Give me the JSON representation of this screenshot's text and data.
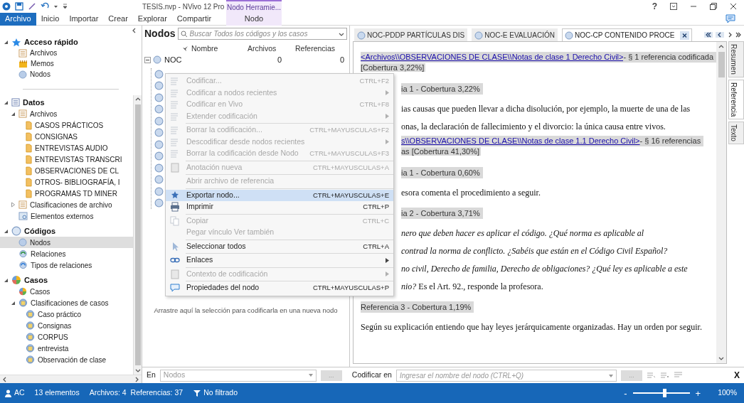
{
  "title_bar": {
    "title": "TESIS.nvp - NVivo 12 Pro",
    "context_group": "Nodo Herramie...",
    "help": "?"
  },
  "ribbon_tabs": [
    {
      "label": "Archivo",
      "selected": true,
      "contextual": false
    },
    {
      "label": "Inicio",
      "selected": false,
      "contextual": false
    },
    {
      "label": "Importar",
      "selected": false,
      "contextual": false
    },
    {
      "label": "Crear",
      "selected": false,
      "contextual": false
    },
    {
      "label": "Explorar",
      "selected": false,
      "contextual": false
    },
    {
      "label": "Compartir",
      "selected": false,
      "contextual": false
    },
    {
      "label": "Nodo",
      "selected": false,
      "contextual": true
    }
  ],
  "sidebar": {
    "quick_access": [
      {
        "label": "Acceso rápido",
        "kind": "star",
        "expanded": true,
        "selected": false,
        "children": [
          {
            "label": "Archivos",
            "kind": "files",
            "selected": false
          },
          {
            "label": "Memos",
            "kind": "memos",
            "selected": false
          },
          {
            "label": "Nodos",
            "kind": "nodes",
            "selected": false
          }
        ]
      }
    ],
    "tree": [
      {
        "label": "Datos",
        "kind": "data",
        "expanded": true,
        "selected": false,
        "children": [
          {
            "label": "Archivos",
            "kind": "files",
            "expanded": true,
            "selected": false,
            "children": [
              {
                "label": "CASOS PRÁCTICOS",
                "kind": "folder",
                "selected": false
              },
              {
                "label": "CONSIGNAS",
                "kind": "folder",
                "selected": false
              },
              {
                "label": "ENTREVISTAS AUDIO",
                "kind": "folder",
                "selected": false
              },
              {
                "label": "ENTREVISTAS TRANSCRI",
                "kind": "folder",
                "selected": false
              },
              {
                "label": "OBSERVACIONES DE CL",
                "kind": "folder",
                "selected": false
              },
              {
                "label": "OTROS- BIBLIOGRAFÍA, I",
                "kind": "folder",
                "selected": false
              },
              {
                "label": "PROGRAMAS TD MINER",
                "kind": "folder",
                "selected": false
              }
            ]
          },
          {
            "label": "Clasificaciones de archivo",
            "kind": "file_classifications",
            "expanded": false,
            "selected": false
          },
          {
            "label": "Elementos externos",
            "kind": "externals",
            "selected": false
          }
        ]
      },
      {
        "label": "Códigos",
        "kind": "codes",
        "expanded": true,
        "selected": false,
        "children": [
          {
            "label": "Nodos",
            "kind": "nodes",
            "selected": true
          },
          {
            "label": "Relaciones",
            "kind": "relations",
            "selected": false
          },
          {
            "label": "Tipos de relaciones",
            "kind": "relation_types",
            "selected": false
          }
        ]
      },
      {
        "label": "Casos",
        "kind": "cases",
        "expanded": true,
        "selected": false,
        "children": [
          {
            "label": "Casos",
            "kind": "case",
            "selected": false
          },
          {
            "label": "Clasificaciones de casos",
            "kind": "case_classifications",
            "expanded": true,
            "selected": false,
            "children": [
              {
                "label": "Caso práctico",
                "kind": "case_classification",
                "selected": false
              },
              {
                "label": "Consignas",
                "kind": "case_classification",
                "selected": false
              },
              {
                "label": "CORPUS",
                "kind": "case_classification",
                "selected": false
              },
              {
                "label": "entrevista",
                "kind": "case_classification",
                "selected": false
              },
              {
                "label": "Observación de clase",
                "kind": "case_classification",
                "selected": false
              }
            ]
          }
        ]
      }
    ]
  },
  "node_list": {
    "title": "Nodos",
    "search": {
      "placeholder": "Buscar Todos los códigos y los casos"
    },
    "columns": [
      "Nombre",
      "Archivos",
      "Referencias"
    ],
    "rows": [
      {
        "name": "NOC",
        "files": "0",
        "references": "0",
        "expanded": true,
        "children": [
          {
            "kind": "node"
          },
          {
            "kind": "node"
          },
          {
            "kind": "node"
          },
          {
            "kind": "node"
          },
          {
            "kind": "node"
          },
          {
            "kind": "node"
          },
          {
            "kind": "node"
          },
          {
            "kind": "node"
          },
          {
            "kind": "node"
          },
          {
            "kind": "node"
          },
          {
            "kind": "node"
          },
          {
            "kind": "node"
          }
        ]
      }
    ],
    "drop_hint": "Arrastre aquí la selección para codificarla en una nueva nodo"
  },
  "context_menu": [
    {
      "kind": "item",
      "label": "Codificar...",
      "shortcut": "CTRL+F2",
      "submenu": false,
      "disabled": true,
      "selected": false
    },
    {
      "kind": "item",
      "label": "Codificar a nodos recientes",
      "submenu": true,
      "disabled": true,
      "selected": false
    },
    {
      "kind": "item",
      "label": "Codificar en Vivo",
      "shortcut": "CTRL+F8",
      "submenu": false,
      "disabled": true,
      "selected": false
    },
    {
      "kind": "item",
      "label": "Extender codificación",
      "submenu": true,
      "disabled": true,
      "selected": false
    },
    {
      "kind": "separator"
    },
    {
      "kind": "item",
      "label": "Borrar la codificación...",
      "shortcut": "CTRL+MAYUSCULAS+F2",
      "submenu": false,
      "disabled": true,
      "selected": false
    },
    {
      "kind": "item",
      "label": "Descodificar desde nodos recientes",
      "submenu": true,
      "disabled": true,
      "selected": false
    },
    {
      "kind": "item",
      "label": "Borrar la codificación desde Nodo",
      "shortcut": "CTRL+MAYUSCULAS+F3",
      "submenu": false,
      "disabled": true,
      "selected": false
    },
    {
      "kind": "separator"
    },
    {
      "kind": "item",
      "label": "Anotación nueva",
      "shortcut": "CTRL+MAYUSCULAS+A",
      "submenu": false,
      "disabled": true,
      "selected": false
    },
    {
      "kind": "separator"
    },
    {
      "kind": "item",
      "label": "Abrir archivo de referencia",
      "submenu": false,
      "disabled": true,
      "selected": false
    },
    {
      "kind": "separator"
    },
    {
      "kind": "item",
      "label": "Exportar nodo...",
      "shortcut": "CTRL+MAYUSCULAS+E",
      "submenu": false,
      "disabled": false,
      "selected": true
    },
    {
      "kind": "item",
      "label": "Imprimir",
      "shortcut": "CTRL+P",
      "submenu": false,
      "disabled": false,
      "selected": false
    },
    {
      "kind": "separator"
    },
    {
      "kind": "item",
      "label": "Copiar",
      "shortcut": "CTRL+C",
      "submenu": false,
      "disabled": true,
      "selected": false
    },
    {
      "kind": "item",
      "label": "Pegar vínculo Ver también",
      "submenu": false,
      "disabled": true,
      "selected": false
    },
    {
      "kind": "separator"
    },
    {
      "kind": "item",
      "label": "Seleccionar todos",
      "shortcut": "CTRL+A",
      "submenu": false,
      "disabled": false,
      "selected": false
    },
    {
      "kind": "separator"
    },
    {
      "kind": "item",
      "label": "Enlaces",
      "submenu": true,
      "disabled": false,
      "selected": false
    },
    {
      "kind": "separator"
    },
    {
      "kind": "item",
      "label": "Contexto de codificación",
      "submenu": true,
      "disabled": true,
      "selected": false
    },
    {
      "kind": "separator"
    },
    {
      "kind": "item",
      "label": "Propiedades del nodo",
      "shortcut": "CTRL+MAYUSCULAS+P",
      "submenu": false,
      "disabled": false,
      "selected": false
    }
  ],
  "detail": {
    "tabs": [
      {
        "label": "NOC-PDDP PARTÍCULAS DIS",
        "selected": false,
        "closable": false
      },
      {
        "label": "NOC-E EVALUACIÓN",
        "selected": false,
        "closable": false
      },
      {
        "label": "NOC-CP CONTENIDO PROCE",
        "selected": true,
        "closable": true
      }
    ],
    "lines": [
      {
        "kind": "source",
        "link": "<Archivos\\\\OBSERVACIONES DE CLASE\\\\Notas de clase 1 Derecho Civil>",
        "text": " - § 1 referencia codificada",
        "coverage": "[Cobertura 3,22%]"
      },
      {
        "kind": "ref",
        "clipped": true,
        "text": "ia 1 - Cobertura 3,22%"
      },
      {
        "kind": "body",
        "clipped": true,
        "italic": false,
        "text": "ias causas que pueden llevar a dicha disolución, por ejemplo, la muerte de una de las"
      },
      {
        "kind": "body",
        "clipped": true,
        "italic": false,
        "text": "onas, la declaración de fallecimiento y el divorcio: la única causa entre vivos."
      },
      {
        "kind": "source",
        "clipped": true,
        "link": "s\\\\OBSERVACIONES DE CLASE\\\\Notas de clase 1.1 Derecho Civil>",
        "text": " - § 16 referencias",
        "coverage": "as  [Cobertura 41,30%]"
      },
      {
        "kind": "ref",
        "clipped": true,
        "text": "ia 1 - Cobertura 0,60%"
      },
      {
        "kind": "body",
        "clipped": true,
        "italic": false,
        "text": "esora comenta el procedimiento a seguir."
      },
      {
        "kind": "ref",
        "clipped": true,
        "text": "ia 2 - Cobertura 3,71%"
      },
      {
        "kind": "body",
        "clipped": true,
        "italic": true,
        "text": "nero que deben hacer es aplicar el código. ¿Qué norma es aplicable al"
      },
      {
        "kind": "body",
        "clipped": true,
        "italic": true,
        "text": "contrad la norma de conflicto. ¿Sabéis que están en el Código Civil Español?"
      },
      {
        "kind": "body",
        "clipped": true,
        "italic": true,
        "text": "no civil, Derecho de familia, Derecho de obligaciones? ¿Qué ley es aplicable a este"
      },
      {
        "kind": "body",
        "clipped": true,
        "italic": false,
        "text": "*nio?* Es el Art. 92., responde la profesora."
      },
      {
        "kind": "ref",
        "text": "Referencia 3 - Cobertura 1,19%"
      },
      {
        "kind": "body",
        "italic": false,
        "text": "Según su explicación entiendo que hay leyes jerárquicamente organizadas. Hay un orden por seguir."
      }
    ],
    "side_tabs": [
      {
        "label": "Resumen",
        "selected": false
      },
      {
        "label": "Referencia",
        "selected": true
      },
      {
        "label": "Texto",
        "selected": false
      }
    ]
  },
  "code_bar": {
    "in_label": "En",
    "in_value": "Nodos",
    "browse": "...",
    "code_in_label": "Codificar en",
    "code_in": {
      "placeholder": "Ingresar el nombre del nodo (CTRL+Q)"
    },
    "browse_2": "...",
    "close": "X"
  },
  "status_bar": {
    "user": "AC",
    "items": "13 elementos",
    "files": "Archivos: 4",
    "references": "Referencias: 37",
    "filter": "No filtrado",
    "zoom": {
      "minus": "-",
      "level": 0.55,
      "plus": "+",
      "reading": "100%"
    }
  }
}
